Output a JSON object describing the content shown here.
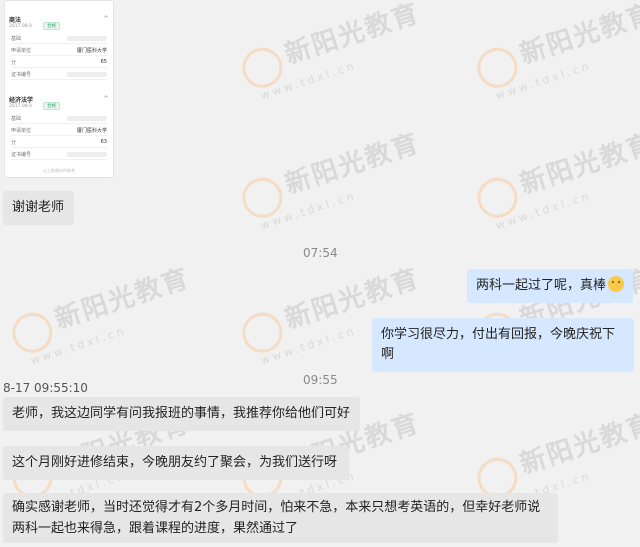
{
  "watermark": {
    "cn": "新阳光教育",
    "en": "www.tdxl.cn"
  },
  "card": {
    "sections": [
      {
        "title": "商法",
        "date": "2017.08.0",
        "tag": "合格",
        "rows": [
          {
            "k": "基础",
            "v": ""
          },
          {
            "k": "申请单位",
            "v": "厦门医科大学"
          },
          {
            "k": "分",
            "v": "65"
          },
          {
            "k": "证书编号",
            "v": ""
          }
        ]
      },
      {
        "title": "经济法学",
        "date": "2017.08.0",
        "tag": "合格",
        "rows": [
          {
            "k": "基础",
            "v": ""
          },
          {
            "k": "申请单位",
            "v": "厦门医科大学"
          },
          {
            "k": "分",
            "v": "63"
          },
          {
            "k": "证书编号",
            "v": ""
          }
        ]
      }
    ],
    "footer": "以上结果仅供参考"
  },
  "messages": [
    {
      "id": "m1",
      "side": "left",
      "text": "谢谢老师"
    },
    {
      "id": "t1",
      "type": "time",
      "text": "07:54"
    },
    {
      "id": "m2",
      "side": "right",
      "text": "两科一起过了呢，真棒"
    },
    {
      "id": "m3",
      "side": "right",
      "text": "你学习很尽力，付出有回报，今晚庆祝下啊"
    },
    {
      "id": "t2",
      "type": "time",
      "text": "09:55"
    },
    {
      "id": "s1",
      "type": "stamp",
      "text": "8-17 09:55:10"
    },
    {
      "id": "m4",
      "side": "left",
      "text": "老师，我这边同学有问我报班的事情，我推荐你给他们可好"
    },
    {
      "id": "m5",
      "side": "left",
      "text": "这个月刚好进修结束，今晚朋友约了聚会，为我们送行呀"
    },
    {
      "id": "m6",
      "side": "left",
      "text": "确实感谢老师，当时还觉得才有2个多月时间，怕来不急，本来只想考英语的，但幸好老师说两科一起也来得急，跟着课程的进度，果然通过了"
    }
  ]
}
